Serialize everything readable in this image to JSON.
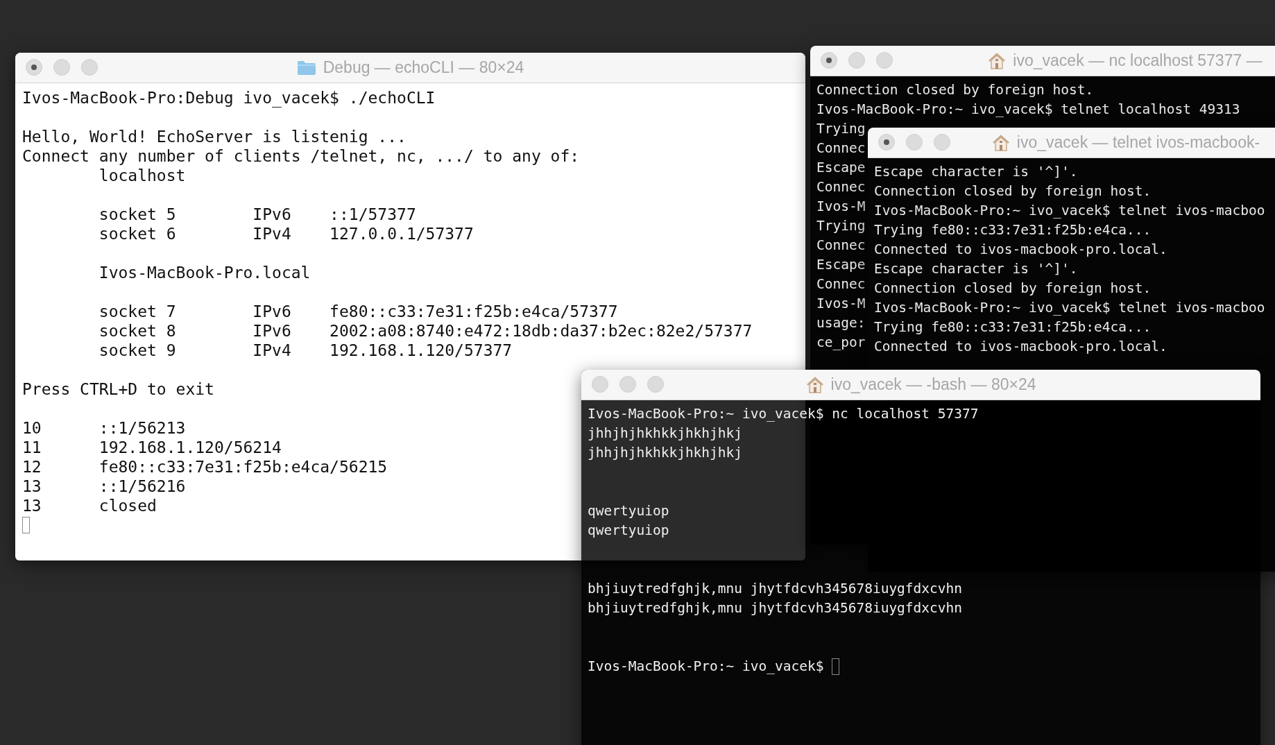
{
  "debug_window": {
    "title": "Debug — echoCLI — 80×24",
    "busy": true,
    "cursor": true,
    "blocks": [
      [
        "Ivos-MacBook-Pro:Debug ivo_vacek$ ./echoCLI"
      ],
      [
        "Hello, World! EchoServer is listenig ...",
        "Connect any number of clients /telnet, nc, .../ to any of:",
        "\tlocalhost"
      ],
      [
        "\tsocket 5\tIPv6\t::1/57377",
        "\tsocket 6\tIPv4\t127.0.0.1/57377"
      ],
      [
        "\tIvos-MacBook-Pro.local"
      ],
      [
        "\tsocket 7\tIPv6\tfe80::c33:7e31:f25b:e4ca/57377",
        "\tsocket 8\tIPv6\t2002:a08:8740:e472:18db:da37:b2ec:82e2/57377",
        "\tsocket 9\tIPv4\t192.168.1.120/57377"
      ],
      [
        "Press CTRL+D to exit"
      ],
      [
        "10\t::1/56213",
        "11\t192.168.1.120/56214",
        "12\tfe80::c33:7e31:f25b:e4ca/56215",
        "13\t::1/56216",
        "13\tclosed"
      ]
    ]
  },
  "nc_window": {
    "title": "ivo_vacek — nc localhost 57377 —",
    "busy": true,
    "blocks": [
      [
        "Connection closed by foreign host.",
        "Ivos-MacBook-Pro:~ ivo_vacek$ telnet localhost 49313",
        "Trying",
        "Connec",
        "Escape",
        "Connec",
        "Ivos-M",
        "Trying",
        "Connec",
        "Escape",
        "Connec",
        "Ivos-M",
        "usage:",
        "ce_por"
      ]
    ]
  },
  "telnet_window": {
    "title": "ivo_vacek — telnet ivos-macbook-",
    "busy": true,
    "blocks": [
      [
        "Escape character is '^]'.",
        "Connection closed by foreign host.",
        "Ivos-MacBook-Pro:~ ivo_vacek$ telnet ivos-macboo",
        "Trying fe80::c33:7e31:f25b:e4ca...",
        "Connected to ivos-macbook-pro.local.",
        "Escape character is '^]'.",
        "Connection closed by foreign host.",
        "Ivos-MacBook-Pro:~ ivo_vacek$ telnet ivos-macboo",
        "Trying fe80::c33:7e31:f25b:e4ca...",
        "Connected to ivos-macbook-pro.local."
      ]
    ]
  },
  "bash_window": {
    "title": "ivo_vacek — -bash — 80×24",
    "busy": false,
    "cursor": true,
    "blocks": [
      [
        "Ivos-MacBook-Pro:~ ivo_vacek$ nc localhost 57377",
        "jhhjhjhkhkkjhkhjhkj",
        "jhhjhjhkhkkjhkhjhkj"
      ],
      [
        "qwertyuiop",
        "qwertyuiop"
      ],
      [
        "bhjiuytredfghjk,mnu jhytfdcvh345678iuygfdxcvhn",
        "bhjiuytredfghjk,mnu jhytfdcvh345678iuygfdxcvhn"
      ],
      [
        "Ivos-MacBook-Pro:~ ivo_vacek$"
      ]
    ]
  }
}
